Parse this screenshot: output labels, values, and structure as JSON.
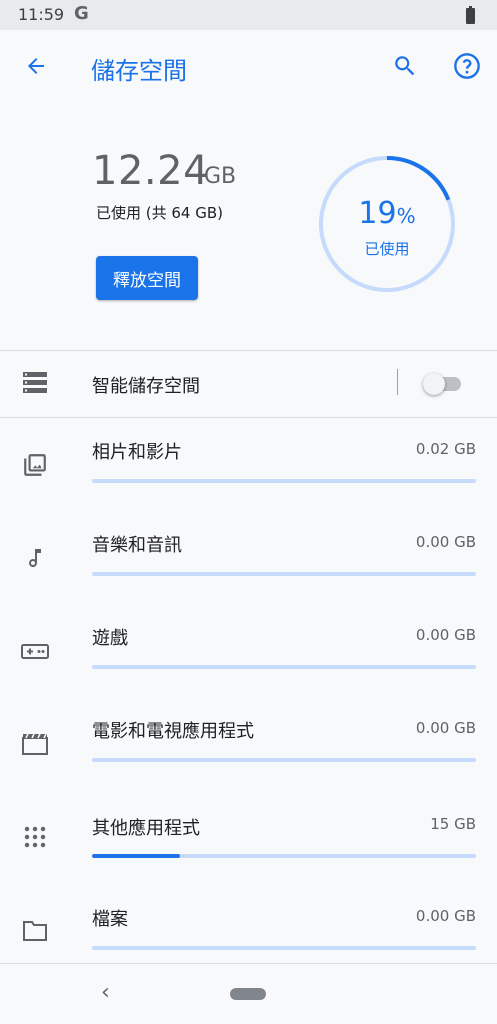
{
  "status_bar": {
    "time": "11:59",
    "g_logo": "G",
    "battery_icon": "battery-icon"
  },
  "app_bar": {
    "title": "儲存空間",
    "back_icon": "arrow-back-icon",
    "search_icon": "search-icon",
    "help_icon": "help-icon"
  },
  "summary": {
    "used_value": "12.24",
    "used_unit": "GB",
    "used_of_total": "已使用 (共 64 GB)",
    "free_up_button": "釋放空間",
    "percent_value": "19",
    "percent_sign": "%",
    "percent_label": "已使用",
    "percent_fraction": 0.19
  },
  "smart_storage": {
    "label": "智能儲存空間",
    "enabled": false
  },
  "categories": [
    {
      "name": "相片和影片",
      "size": "0.02 GB",
      "fraction": 0.0,
      "icon": "photo-icon"
    },
    {
      "name": "音樂和音訊",
      "size": "0.00 GB",
      "fraction": 0.0,
      "icon": "music-note-icon"
    },
    {
      "name": "遊戲",
      "size": "0.00 GB",
      "fraction": 0.0,
      "icon": "gamepad-icon"
    },
    {
      "name": "電影和電視應用程式",
      "size": "0.00 GB",
      "fraction": 0.0,
      "icon": "movie-icon"
    },
    {
      "name": "其他應用程式",
      "size": "15 GB",
      "fraction": 0.23,
      "icon": "apps-grid-icon"
    },
    {
      "name": "檔案",
      "size": "0.00 GB",
      "fraction": 0.0,
      "icon": "folder-icon"
    }
  ],
  "colors": {
    "accent": "#1a73e8",
    "bar_track": "#c6dafc",
    "ring_track": "#c6dafc"
  },
  "nav_bar": {
    "back_label": "‹"
  }
}
